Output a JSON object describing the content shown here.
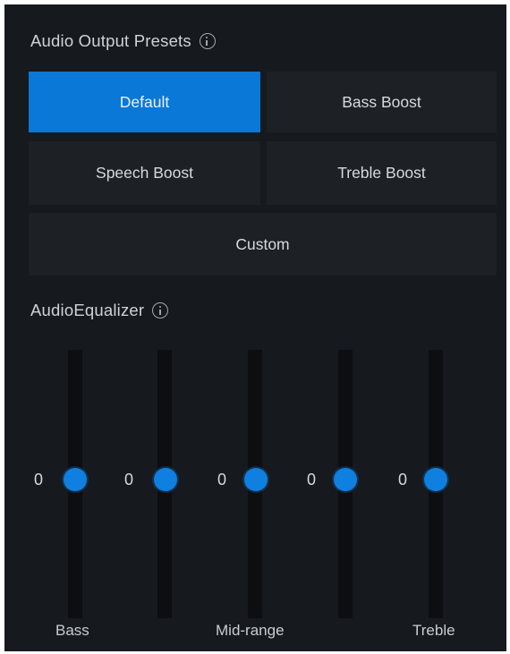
{
  "presets": {
    "title": "Audio Output Presets",
    "info_icon": "info-circle-icon",
    "buttons": {
      "default": "Default",
      "bass_boost": "Bass Boost",
      "speech_boost": "Speech Boost",
      "treble_boost": "Treble Boost",
      "custom": "Custom"
    },
    "selected": "Default"
  },
  "equalizer": {
    "title": "AudioEqualizer",
    "info_icon": "info-circle-icon",
    "bands": [
      {
        "value": "0"
      },
      {
        "value": "0"
      },
      {
        "value": "0"
      },
      {
        "value": "0"
      },
      {
        "value": "0"
      }
    ],
    "labels": {
      "bass": "Bass",
      "midrange": "Mid-range",
      "treble": "Treble"
    }
  },
  "colors": {
    "panel_bg": "#16191d",
    "button_bg": "#1d2025",
    "accent": "#0a78d6",
    "slider_thumb": "#0f7fe0",
    "slider_track": "#0c0e11",
    "text": "#d7dadd"
  }
}
